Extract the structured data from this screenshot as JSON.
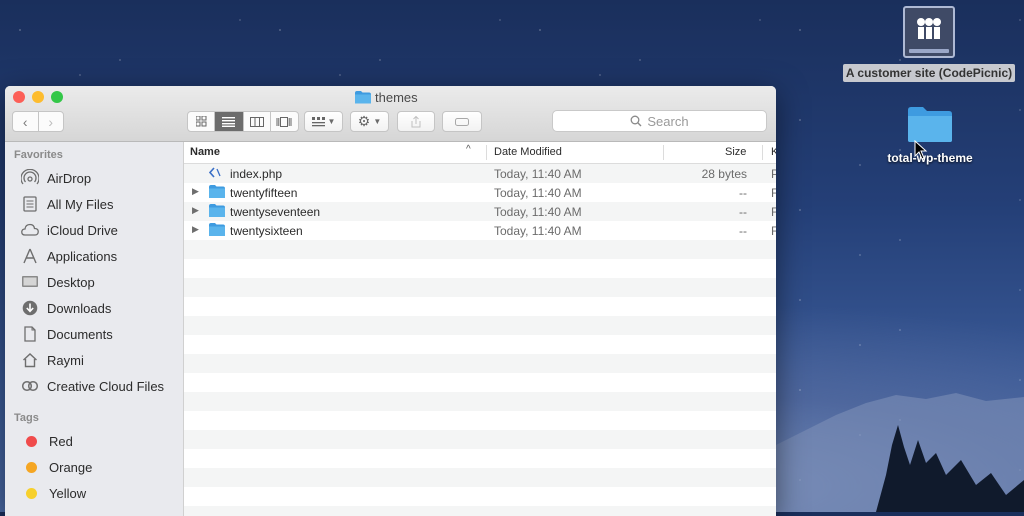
{
  "desktop": {
    "drive_label": "A customer site (CodePicnic)",
    "folder_label": "total-wp-theme"
  },
  "window": {
    "title": "themes",
    "search_placeholder": "Search",
    "view_modes": [
      "icon-view-icon",
      "list-view-icon",
      "column-view-icon",
      "coverflow-view-icon"
    ],
    "active_view": "list-view-icon"
  },
  "sidebar": {
    "favorites_header": "Favorites",
    "favorites": [
      {
        "label": "AirDrop",
        "icon": "airdrop-icon"
      },
      {
        "label": "All My Files",
        "icon": "all-files-icon"
      },
      {
        "label": "iCloud Drive",
        "icon": "cloud-icon"
      },
      {
        "label": "Applications",
        "icon": "applications-icon"
      },
      {
        "label": "Desktop",
        "icon": "desktop-icon"
      },
      {
        "label": "Downloads",
        "icon": "downloads-icon"
      },
      {
        "label": "Documents",
        "icon": "documents-icon"
      },
      {
        "label": "Raymi",
        "icon": "home-icon"
      },
      {
        "label": "Creative Cloud Files",
        "icon": "creative-cloud-icon"
      }
    ],
    "tags_header": "Tags",
    "tags": [
      {
        "label": "Red",
        "color": "#f04b4b"
      },
      {
        "label": "Orange",
        "color": "#f5a623"
      },
      {
        "label": "Yellow",
        "color": "#f7d02c"
      }
    ]
  },
  "columns": {
    "name": "Name",
    "date": "Date Modified",
    "size": "Size",
    "kind": "K"
  },
  "files": [
    {
      "name": "index.php",
      "date": "Today, 11:40 AM",
      "size": "28 bytes",
      "kind": "P",
      "type": "file"
    },
    {
      "name": "twentyfifteen",
      "date": "Today, 11:40 AM",
      "size": "--",
      "kind": "F",
      "type": "folder"
    },
    {
      "name": "twentyseventeen",
      "date": "Today, 11:40 AM",
      "size": "--",
      "kind": "F",
      "type": "folder"
    },
    {
      "name": "twentysixteen",
      "date": "Today, 11:40 AM",
      "size": "--",
      "kind": "F",
      "type": "folder"
    }
  ],
  "colors": {
    "folder_blue": "#5ab4ec",
    "traffic_close": "#fc5f57",
    "traffic_min": "#fdbc2e",
    "traffic_max": "#33c748"
  }
}
